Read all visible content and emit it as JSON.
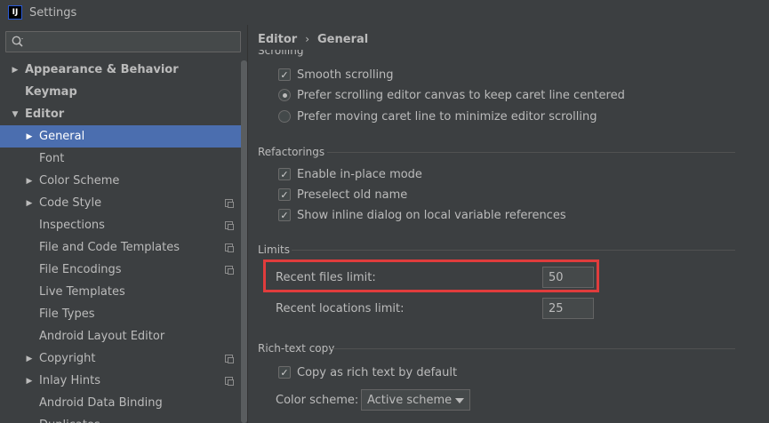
{
  "window": {
    "title": "Settings",
    "logo_text": "IJ"
  },
  "search": {
    "placeholder": "",
    "value": ""
  },
  "sidebar": {
    "items": [
      {
        "label": "Appearance & Behavior",
        "top": true,
        "arrow": "right"
      },
      {
        "label": "Keymap",
        "top": true,
        "arrow": ""
      },
      {
        "label": "Editor",
        "top": true,
        "arrow": "down"
      },
      {
        "label": "General",
        "arrow": "right",
        "selected": true
      },
      {
        "label": "Font",
        "arrow": ""
      },
      {
        "label": "Color Scheme",
        "arrow": "right"
      },
      {
        "label": "Code Style",
        "arrow": "right",
        "copy": true
      },
      {
        "label": "Inspections",
        "arrow": "",
        "copy": true
      },
      {
        "label": "File and Code Templates",
        "arrow": "",
        "copy": true
      },
      {
        "label": "File Encodings",
        "arrow": "",
        "copy": true
      },
      {
        "label": "Live Templates",
        "arrow": ""
      },
      {
        "label": "File Types",
        "arrow": ""
      },
      {
        "label": "Android Layout Editor",
        "arrow": ""
      },
      {
        "label": "Copyright",
        "arrow": "right",
        "copy": true
      },
      {
        "label": "Inlay Hints",
        "arrow": "right",
        "copy": true
      },
      {
        "label": "Android Data Binding",
        "arrow": ""
      },
      {
        "label": "Duplicates",
        "arrow": ""
      }
    ]
  },
  "breadcrumb": {
    "parent": "Editor",
    "separator": "›",
    "current": "General"
  },
  "scrolling": {
    "section_title": "Scrolling",
    "smooth_scrolling": "Smooth scrolling",
    "smooth_scrolling_checked": true,
    "prefer_canvas": "Prefer scrolling editor canvas to keep caret line centered",
    "prefer_canvas_selected": true,
    "prefer_caret": "Prefer moving caret line to minimize editor scrolling",
    "prefer_caret_selected": false
  },
  "refactorings": {
    "section_title": "Refactorings",
    "in_place": "Enable in-place mode",
    "in_place_checked": true,
    "preselect": "Preselect old name",
    "preselect_checked": true,
    "inline_dialog": "Show inline dialog on local variable references",
    "inline_dialog_checked": true
  },
  "limits": {
    "section_title": "Limits",
    "recent_files_label": "Recent files limit:",
    "recent_files_value": "50",
    "recent_locations_label": "Recent locations limit:",
    "recent_locations_value": "25"
  },
  "rich_text": {
    "section_title": "Rich-text copy",
    "copy_rich": "Copy as rich text by default",
    "copy_rich_checked": true,
    "color_scheme_label": "Color scheme:",
    "color_scheme_value": "Active scheme"
  },
  "colors": {
    "selection": "#4b6eaf",
    "highlight": "#e03c3c",
    "background": "#3c3f41"
  }
}
